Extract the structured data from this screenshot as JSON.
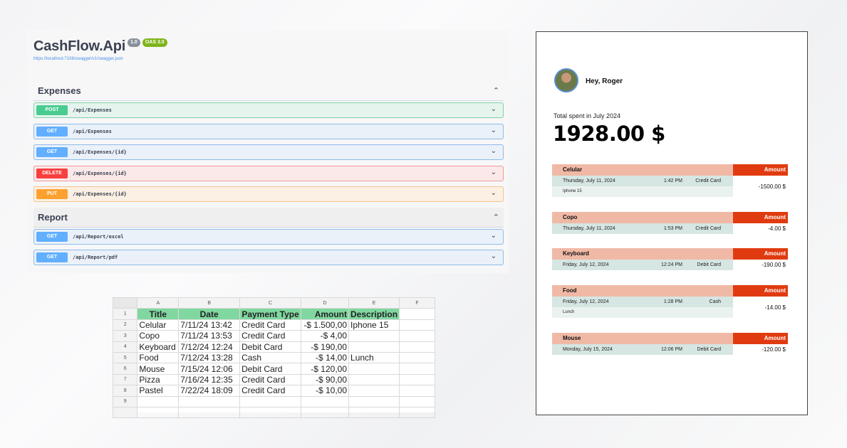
{
  "swagger": {
    "title": "CashFlow.Api",
    "version_badge": "1.0",
    "oas_badge": "OAS 3.0",
    "url": "https://localhost:7108/swagger/v1/swagger.json",
    "sections": [
      {
        "label": "Expenses",
        "operations": [
          {
            "method": "POST",
            "path": "/api/Expenses"
          },
          {
            "method": "GET",
            "path": "/api/Expenses"
          },
          {
            "method": "GET",
            "path": "/api/Expenses/{id}"
          },
          {
            "method": "DELETE",
            "path": "/api/Expenses/{id}"
          },
          {
            "method": "PUT",
            "path": "/api/Expenses/{id}"
          }
        ]
      },
      {
        "label": "Report",
        "operations": [
          {
            "method": "GET",
            "path": "/api/Report/excel"
          },
          {
            "method": "GET",
            "path": "/api/Report/pdf"
          }
        ]
      }
    ],
    "colors": {
      "POST": "#49cc90",
      "GET": "#61affe",
      "DELETE": "#f93e3e",
      "PUT": "#fca130"
    }
  },
  "sheet": {
    "col_letters": [
      "A",
      "B",
      "C",
      "D",
      "E",
      "F"
    ],
    "row_numbers": [
      "1",
      "2",
      "3",
      "4",
      "5",
      "6",
      "7",
      "8",
      "9"
    ],
    "headers": [
      "Title",
      "Date",
      "Payment Type",
      "Amount",
      "Description"
    ],
    "rows": [
      [
        "Celular",
        "7/11/24 13:42",
        "Credit Card",
        "-$ 1.500,00",
        "Iphone 15"
      ],
      [
        "Copo",
        "7/11/24 13:53",
        "Credit Card",
        "-$ 4,00",
        ""
      ],
      [
        "Keyboard",
        "7/12/24 12:24",
        "Debit Card",
        "-$ 190,00",
        ""
      ],
      [
        "Food",
        "7/12/24 13:28",
        "Cash",
        "-$ 14,00",
        "Lunch"
      ],
      [
        "Mouse",
        "7/15/24 12:06",
        "Debit Card",
        "-$ 120,00",
        ""
      ],
      [
        "Pizza",
        "7/16/24 12:35",
        "Credit Card",
        "-$ 90,00",
        ""
      ],
      [
        "Pastel",
        "7/22/24 18:09",
        "Credit Card",
        "-$ 10,00",
        ""
      ]
    ]
  },
  "report": {
    "greeting": "Hey, Roger",
    "total_label": "Total spent in July 2024",
    "total_value": "1928.00 $",
    "amount_header": "Amount",
    "expenses": [
      {
        "title": "Celular",
        "date": "Thursday, July 11, 2024",
        "time": "1:42 PM",
        "payment": "Credit Card",
        "description": "Iphone 15",
        "amount": "-1500.00 $"
      },
      {
        "title": "Copo",
        "date": "Thursday, July 11, 2024",
        "time": "1:53 PM",
        "payment": "Credit Card",
        "description": "",
        "amount": "-4.00 $"
      },
      {
        "title": "Keyboard",
        "date": "Friday, July 12, 2024",
        "time": "12:24 PM",
        "payment": "Debit Card",
        "description": "",
        "amount": "-190.00 $"
      },
      {
        "title": "Food",
        "date": "Friday, July 12, 2024",
        "time": "1:28 PM",
        "payment": "Cash",
        "description": "Lunch",
        "amount": "-14.00 $"
      },
      {
        "title": "Mouse",
        "date": "Monday, July 15, 2024",
        "time": "12:06 PM",
        "payment": "Debit Card",
        "description": "",
        "amount": "-120.00 $"
      }
    ]
  }
}
